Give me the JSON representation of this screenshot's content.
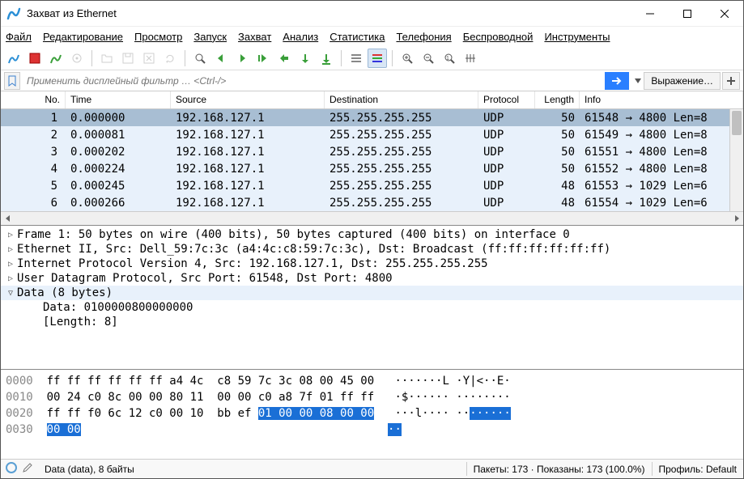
{
  "title": "Захват из Ethernet",
  "menu": [
    "Файл",
    "Редактирование",
    "Просмотр",
    "Запуск",
    "Захват",
    "Анализ",
    "Статистика",
    "Телефония",
    "Беспроводной",
    "Инструменты"
  ],
  "filter": {
    "placeholder": "Применить дисплейный фильтр … <Ctrl-/>",
    "expression_label": "Выражение…"
  },
  "columns": {
    "no": "No.",
    "time": "Time",
    "source": "Source",
    "destination": "Destination",
    "protocol": "Protocol",
    "length": "Length",
    "info": "Info"
  },
  "packets": [
    {
      "no": "1",
      "time": "0.000000",
      "src": "192.168.127.1",
      "dst": "255.255.255.255",
      "proto": "UDP",
      "len": "50",
      "info": "61548 → 4800 Len=8",
      "sel": true
    },
    {
      "no": "2",
      "time": "0.000081",
      "src": "192.168.127.1",
      "dst": "255.255.255.255",
      "proto": "UDP",
      "len": "50",
      "info": "61549 → 4800 Len=8"
    },
    {
      "no": "3",
      "time": "0.000202",
      "src": "192.168.127.1",
      "dst": "255.255.255.255",
      "proto": "UDP",
      "len": "50",
      "info": "61551 → 4800 Len=8"
    },
    {
      "no": "4",
      "time": "0.000224",
      "src": "192.168.127.1",
      "dst": "255.255.255.255",
      "proto": "UDP",
      "len": "50",
      "info": "61552 → 4800 Len=8"
    },
    {
      "no": "5",
      "time": "0.000245",
      "src": "192.168.127.1",
      "dst": "255.255.255.255",
      "proto": "UDP",
      "len": "48",
      "info": "61553 → 1029 Len=6"
    },
    {
      "no": "6",
      "time": "0.000266",
      "src": "192.168.127.1",
      "dst": "255.255.255.255",
      "proto": "UDP",
      "len": "48",
      "info": "61554 → 1029 Len=6"
    }
  ],
  "details": [
    {
      "type": "collapsed",
      "text": "Frame 1: 50 bytes on wire (400 bits), 50 bytes captured (400 bits) on interface 0"
    },
    {
      "type": "collapsed",
      "text": "Ethernet II, Src: Dell_59:7c:3c (a4:4c:c8:59:7c:3c), Dst: Broadcast (ff:ff:ff:ff:ff:ff)"
    },
    {
      "type": "collapsed",
      "text": "Internet Protocol Version 4, Src: 192.168.127.1, Dst: 255.255.255.255"
    },
    {
      "type": "collapsed",
      "text": "User Datagram Protocol, Src Port: 61548, Dst Port: 4800"
    },
    {
      "type": "expanded",
      "text": "Data (8 bytes)",
      "sel": true
    },
    {
      "type": "leaf",
      "text": "Data: 0100000800000000"
    },
    {
      "type": "leaf",
      "text": "[Length: 8]"
    }
  ],
  "hex": {
    "lines": [
      {
        "offset": "0000",
        "bytes": "ff ff ff ff ff ff a4 4c  c8 59 7c 3c 08 00 45 00",
        "ascii": "·······L ·Y|<··E·"
      },
      {
        "offset": "0010",
        "bytes": "00 24 c0 8c 00 00 80 11  00 00 c0 a8 7f 01 ff ff",
        "ascii": "·$······ ········"
      },
      {
        "offset": "0020",
        "bytes_pre": "ff ff f0 6c 12 c0 00 10  bb ef ",
        "bytes_hl": "01 00 00 08 00 00",
        "ascii_pre": "···l···· ··",
        "ascii_hl": "······"
      },
      {
        "offset": "0030",
        "bytes_hl": "00 00",
        "ascii_hl": "··"
      }
    ]
  },
  "status": {
    "left": "Data (data), 8 байты",
    "mid": "Пакеты: 173 · Показаны: 173 (100.0%)",
    "right": "Профиль: Default"
  }
}
